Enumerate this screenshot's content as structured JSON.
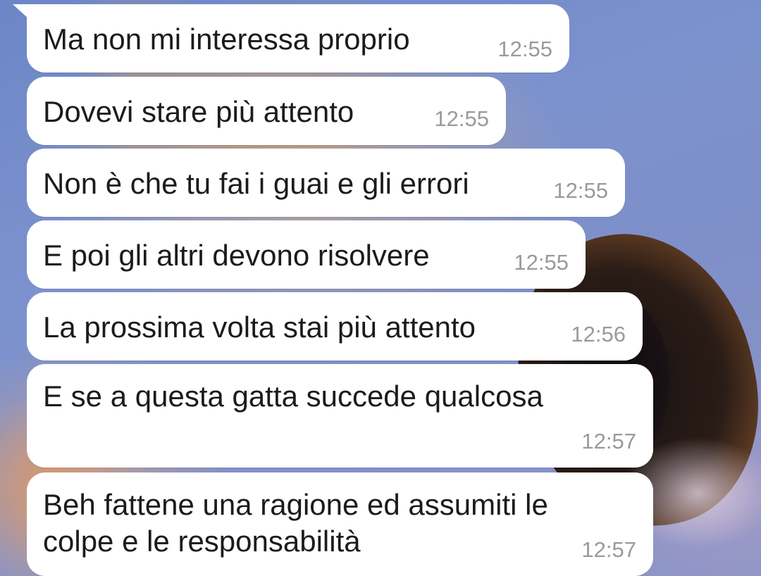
{
  "chat": {
    "messages": [
      {
        "text": "Ma non mi interessa proprio",
        "time": "12:55"
      },
      {
        "text": "Dovevi stare più attento",
        "time": "12:55"
      },
      {
        "text": "Non è che tu fai i guai e gli errori",
        "time": "12:55"
      },
      {
        "text": "E poi gli altri devono risolvere",
        "time": "12:55"
      },
      {
        "text": "La prossima volta stai più attento",
        "time": "12:56"
      },
      {
        "text": "E se a questa gatta succede qualcosa",
        "time": "12:57"
      },
      {
        "text": "Beh fattene una ragione ed assumiti le colpe e le responsabilità",
        "time": "12:57"
      }
    ]
  },
  "colors": {
    "bubble_background": "#ffffff",
    "message_text": "#1b1b1b",
    "timestamp_text": "#9a9a9a",
    "wallpaper_primary": "#7c92ce"
  }
}
